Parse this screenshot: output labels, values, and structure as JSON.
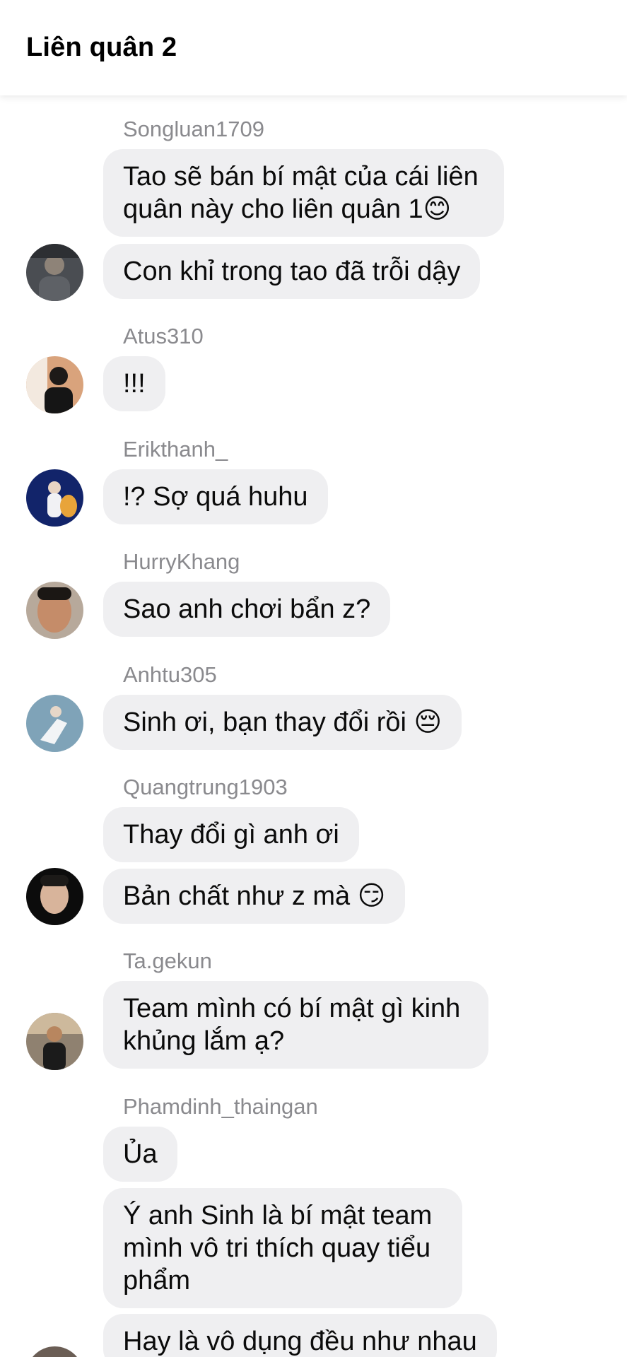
{
  "header": {
    "title": "Liên quân 2"
  },
  "messages": [
    {
      "sender": "Songluan1709",
      "bubbles": [
        "Tao sẽ bán bí mật của cái liên quân này cho liên quân 1😊",
        "Con khỉ trong tao đã trỗi dậy"
      ]
    },
    {
      "sender": "Atus310",
      "bubbles": [
        "!!!"
      ]
    },
    {
      "sender": "Erikthanh_",
      "bubbles": [
        "!? Sợ quá huhu"
      ]
    },
    {
      "sender": "HurryKhang",
      "bubbles": [
        "Sao anh chơi bẩn z?"
      ]
    },
    {
      "sender": "Anhtu305",
      "bubbles": [
        "Sinh ơi, bạn thay đổi rồi 😔"
      ]
    },
    {
      "sender": "Quangtrung1903",
      "bubbles": [
        "Thay đổi gì anh ơi",
        "Bản chất như z mà 😏"
      ]
    },
    {
      "sender": "Ta.gekun",
      "bubbles": [
        "Team mình có bí mật gì kinh khủng lắm ạ?"
      ]
    },
    {
      "sender": "Phamdinh_thaingan",
      "bubbles": [
        "Ủa",
        "Ý anh Sinh là bí mật team mình vô tri thích quay tiểu phẩm",
        "Hay là vô dụng đều như nhau"
      ]
    }
  ],
  "colors": {
    "bubble_bg": "#efeff1",
    "sender_text": "#8a8a8e",
    "message_text": "#0b0b0b",
    "header_bg": "#ffffff"
  }
}
